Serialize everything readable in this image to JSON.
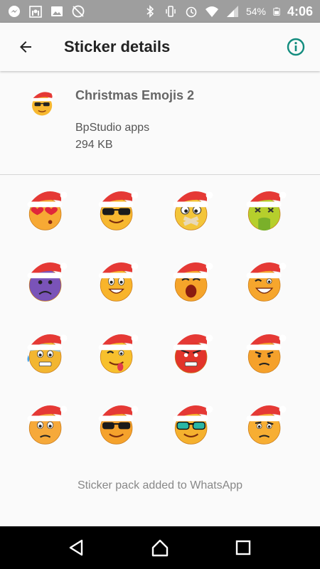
{
  "status_bar": {
    "battery_percent": "54%",
    "time": "4:06"
  },
  "app_bar": {
    "title": "Sticker details"
  },
  "pack": {
    "name": "Christmas Emojis 2",
    "publisher": "BpStudio apps",
    "size": "294 KB"
  },
  "stickers": [
    {
      "name": "sticker-heart-eyes",
      "face": "#f7a934",
      "expr": "hearts"
    },
    {
      "name": "sticker-sunglasses",
      "face": "#f7b830",
      "expr": "shades"
    },
    {
      "name": "sticker-taped-mouth",
      "face": "#f3c53a",
      "expr": "taped"
    },
    {
      "name": "sticker-sick-green",
      "face": "#b6cf2c",
      "expr": "sick"
    },
    {
      "name": "sticker-purple-sad",
      "face": "#7a53b8",
      "expr": "sad"
    },
    {
      "name": "sticker-smile-teeth",
      "face": "#f8b42b",
      "expr": "grin"
    },
    {
      "name": "sticker-screaming",
      "face": "#f5a42a",
      "expr": "scream"
    },
    {
      "name": "sticker-wink-laugh",
      "face": "#f6a62d",
      "expr": "laugh"
    },
    {
      "name": "sticker-cold-sweat",
      "face": "#f2b631",
      "expr": "cold"
    },
    {
      "name": "sticker-tongue-out",
      "face": "#f7c02d",
      "expr": "tongue"
    },
    {
      "name": "sticker-angry-red",
      "face": "#e2342a",
      "expr": "angry"
    },
    {
      "name": "sticker-frown",
      "face": "#f5a12b",
      "expr": "frown"
    },
    {
      "name": "sticker-worried",
      "face": "#f6a93a",
      "expr": "worried"
    },
    {
      "name": "sticker-black-shades",
      "face": "#f5a22c",
      "expr": "shades"
    },
    {
      "name": "sticker-teal-shades",
      "face": "#f5b12e",
      "expr": "teal"
    },
    {
      "name": "sticker-confused",
      "face": "#f7ae33",
      "expr": "confused"
    }
  ],
  "footer": {
    "added_text": "Sticker pack added to WhatsApp"
  },
  "colors": {
    "accent": "#128c7e",
    "status_bar": "#9e9e9e",
    "hat_red": "#e53935"
  },
  "icons": {
    "back": "arrow-left-icon",
    "info": "info-circle-icon",
    "nav_back": "triangle-back-icon",
    "nav_home": "home-icon",
    "nav_recent": "square-recent-icon"
  }
}
